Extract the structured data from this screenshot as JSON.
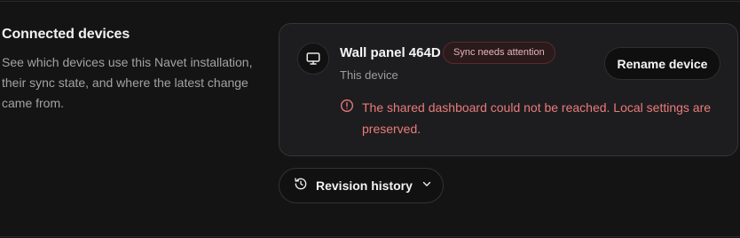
{
  "section": {
    "title": "Connected devices",
    "description": "See which devices use this Navet installation, their sync state, and where the latest change came from."
  },
  "device": {
    "icon": "monitor-icon",
    "name": "Wall panel 464D",
    "status_badge": "Sync needs attention",
    "subtitle": "This device",
    "rename_label": "Rename device",
    "error_icon": "alert-circle-icon",
    "error_message": "The shared dashboard could not be reached. Local settings are preserved."
  },
  "revision": {
    "icon": "history-icon",
    "label": "Revision history",
    "chevron": "chevron-down-icon"
  },
  "colors": {
    "background": "#141415",
    "card": "#1d1d1f",
    "error": "#ea7b7a",
    "badge_bg": "#2a1a1b",
    "badge_text": "#e6b5b8"
  }
}
